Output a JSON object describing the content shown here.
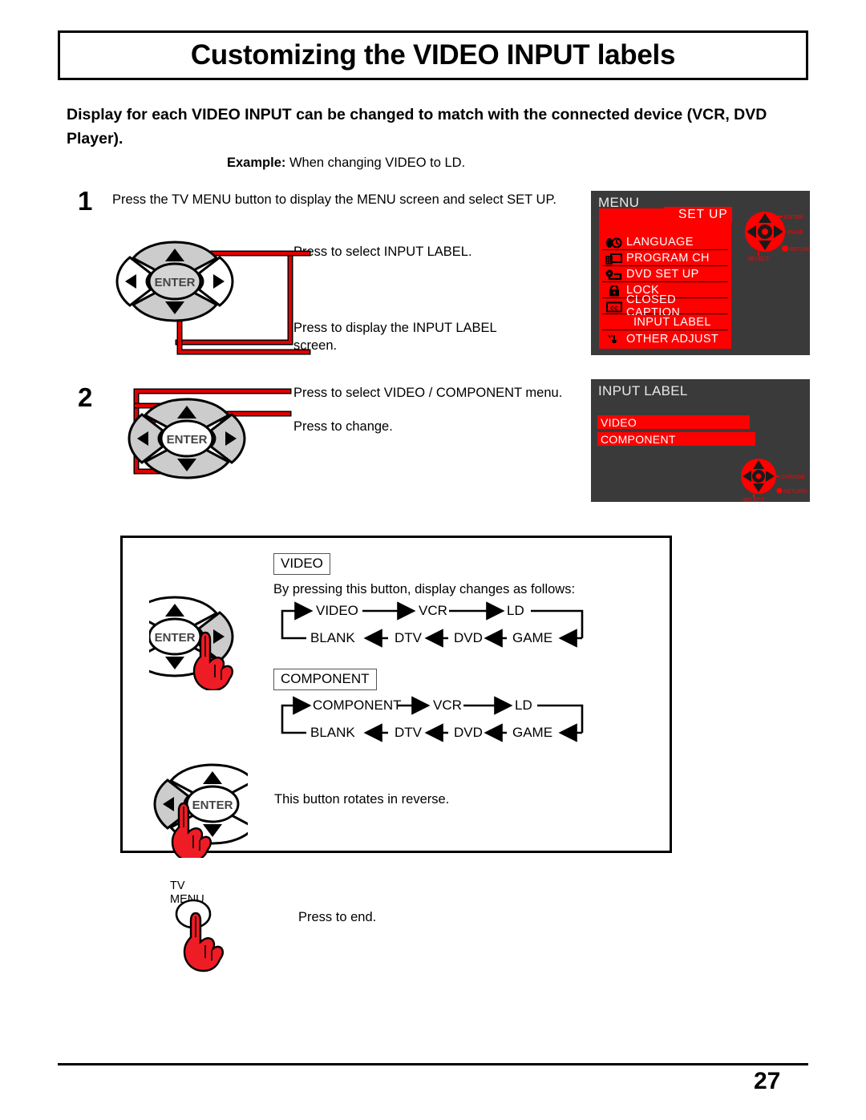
{
  "page": {
    "title": "Customizing the VIDEO INPUT labels",
    "page_number": "27"
  },
  "intro": {
    "description": "Display for each VIDEO INPUT can be changed to match with the connected device (VCR, DVD Player).",
    "example_label": "Example:",
    "example_text": "When changing VIDEO to LD."
  },
  "steps": [
    {
      "number": "1",
      "lead": "Press the TV MENU button to display the MENU screen and select SET UP.",
      "note_1": "Press to select INPUT LABEL.",
      "note_2": "Press to display the INPUT LABEL screen."
    },
    {
      "number": "2",
      "note_1": "Press to select VIDEO / COMPONENT menu.",
      "note_2": "Press to change."
    }
  ],
  "dpad": {
    "enter_label": "ENTER",
    "enter_label_clipped_right": "NTER",
    "enter_label_clipped_left": "ENTE"
  },
  "cycle_box": {
    "video_chip": "VIDEO",
    "component_chip": "COMPONENT",
    "follows_text": "By pressing this button, display changes as follows:",
    "video_cycle_top": [
      "VIDEO",
      "VCR",
      "LD"
    ],
    "video_cycle_bottom": [
      "BLANK",
      "DTV",
      "DVD",
      "GAME"
    ],
    "component_cycle_top": [
      "COMPONENT",
      "VCR",
      "LD"
    ],
    "component_cycle_bottom": [
      "BLANK",
      "DTV",
      "DVD",
      "GAME"
    ],
    "reverse_text": "This button rotates in reverse."
  },
  "tv_menu": {
    "label_line1": "TV",
    "label_line2": "MENU",
    "end_text": "Press to end."
  },
  "osd_menu": {
    "title": "MENU",
    "tab_label": "SET UP",
    "items": [
      {
        "label": "LANGUAGE",
        "icon": "language-icon"
      },
      {
        "label": "PROGRAM  CH",
        "icon": "program-ch-icon"
      },
      {
        "label": "DVD  SET  UP",
        "icon": "dvd-setup-icon"
      },
      {
        "label": "LOCK",
        "icon": "lock-icon"
      },
      {
        "label": "CLOSED CAPTION",
        "icon": "closed-caption-icon"
      },
      {
        "label": "INPUT  LABEL",
        "icon": "none"
      },
      {
        "label": "OTHER  ADJUST",
        "icon": "other-adjust-icon"
      }
    ],
    "navpad": {
      "enter": "ENTER",
      "page": "PAGE",
      "return": "RETURN",
      "select": "SELECT"
    }
  },
  "osd_input_label": {
    "title": "INPUT LABEL",
    "rows": [
      "VIDEO",
      "COMPONENT"
    ],
    "navpad": {
      "change": "CHANGE",
      "return": "RETURN",
      "select": "SELECT"
    }
  },
  "colors": {
    "osd_red": "#fe0000",
    "osd_background": "#3a3a3a",
    "callout_red": "#e00000",
    "hand_red": "#ee1c25",
    "dpad_gray": "#cccccc"
  }
}
